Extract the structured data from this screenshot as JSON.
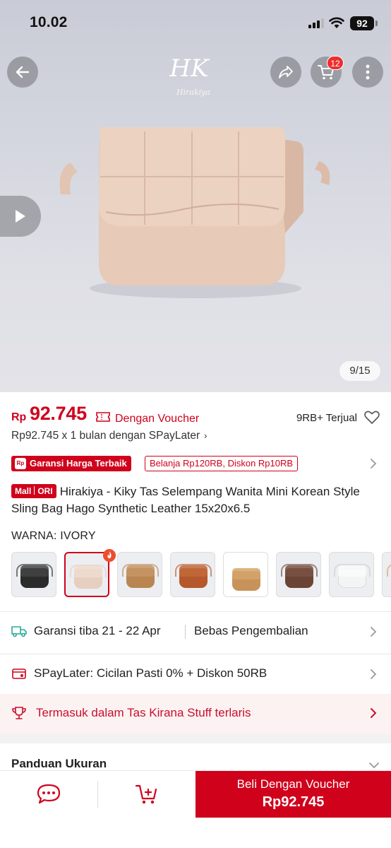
{
  "status_bar": {
    "time": "10.02",
    "battery": "92"
  },
  "hero": {
    "brand_logo": "HK",
    "brand_script": "Hirakiya",
    "cart_count": "12",
    "image_counter": "9/15"
  },
  "icons": {
    "back": "arrow-left-icon",
    "share": "share-icon",
    "cart": "cart-icon",
    "more": "more-vertical-icon",
    "play": "play-icon"
  },
  "price": {
    "currency": "Rp",
    "amount": "92.745",
    "voucher_label": "Dengan Voucher",
    "sold": "9RB+ Terjual",
    "spaylater": "Rp92.745 x 1 bulan dengan SPayLater"
  },
  "guarantee": {
    "badge": "Garansi Harga Terbaik",
    "badge_icon": "Rp",
    "discount": "Belanja Rp120RB, Diskon Rp10RB"
  },
  "product": {
    "mall_label": "Mall",
    "ori_label": "ORI",
    "title": "Hirakiya - Kiky Tas Selempang Wanita Mini Korean Style Sling Bag Hago Synthetic Leather 15x20x6.5"
  },
  "variant": {
    "label": "WARNA: IVORY",
    "swatch_colors": [
      "#2b2b2b",
      "#e6cfc0",
      "#b98652",
      "#b5582b",
      "#c7935a",
      "#6b4436",
      "#f4f4f4"
    ]
  },
  "info_rows": {
    "shipping": "Garansi tiba 21 - 22 Apr",
    "returns": "Bebas Pengembalian",
    "spaylater_promo": "SPayLater: Cicilan Pasti 0% + Diskon 50RB",
    "bestseller": "Termasuk dalam Tas Kirana Stuff terlaris"
  },
  "size_guide": {
    "label": "Panduan Ukuran"
  },
  "bottom_bar": {
    "buy_label": "Beli Dengan Voucher",
    "buy_price": "Rp92.745"
  },
  "colors": {
    "accent": "#d0011b",
    "bestseller_bg": "#fdf2f2",
    "shipping_icon": "#26aa99"
  }
}
